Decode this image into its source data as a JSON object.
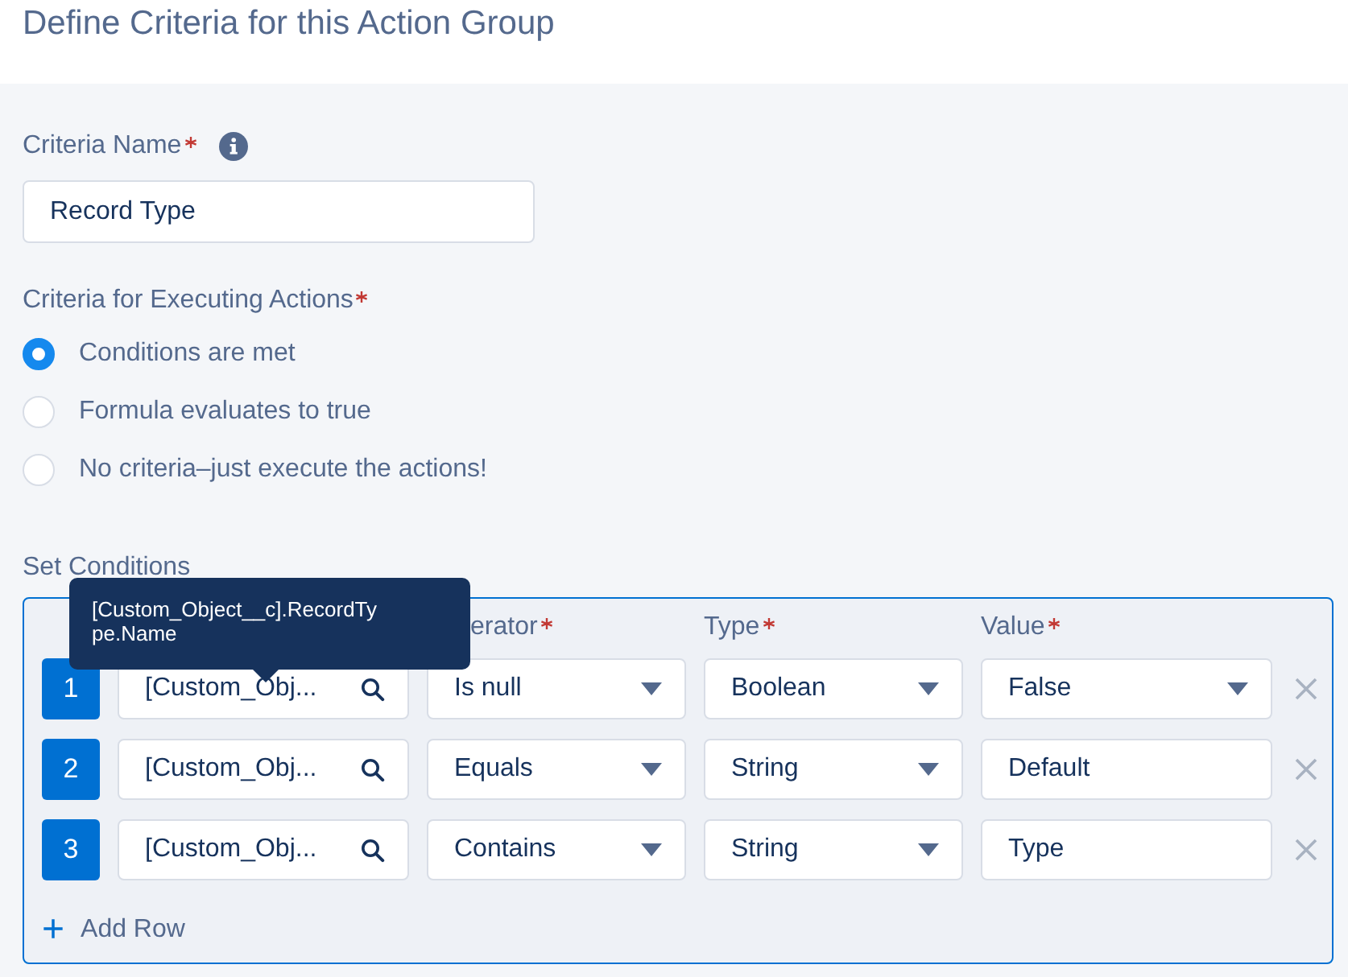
{
  "title": "Define Criteria for this Action Group",
  "criteria_name": {
    "label": "Criteria Name",
    "required": true,
    "value": "Record Type"
  },
  "execution": {
    "label": "Criteria for Executing Actions",
    "required": true,
    "options": [
      {
        "label": "Conditions are met",
        "selected": true
      },
      {
        "label": "Formula evaluates to true",
        "selected": false
      },
      {
        "label": "No criteria–just execute the actions!",
        "selected": false
      }
    ]
  },
  "conditions": {
    "label": "Set Conditions",
    "columns": [
      {
        "label": "erator",
        "required": true
      },
      {
        "label": "Type",
        "required": true
      },
      {
        "label": "Value",
        "required": true
      }
    ],
    "rows": [
      {
        "number": "1",
        "field": "[Custom_Obj...",
        "operator": "Is null",
        "type": "Boolean",
        "value": "False",
        "kind": "picklist"
      },
      {
        "number": "2",
        "field": "[Custom_Obj...",
        "operator": "Equals",
        "type": "String",
        "value": "Default",
        "kind": "text"
      },
      {
        "number": "3",
        "field": "[Custom_Obj...",
        "operator": "Contains",
        "type": "String",
        "value": "Type",
        "kind": "text"
      }
    ],
    "add_row": {
      "icon": "+",
      "label": "Add Row"
    },
    "tooltip": "[Custom_Object__c].RecordTy\npe.Name"
  }
}
